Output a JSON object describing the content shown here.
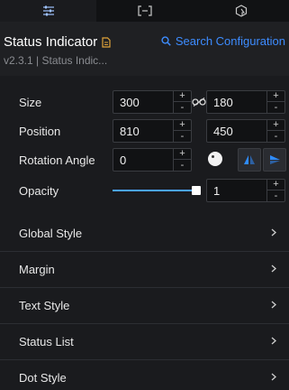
{
  "tabs": [
    {
      "name": "tab-style-settings",
      "icon": "sliders-icon",
      "active": true
    },
    {
      "name": "tab-data",
      "icon": "bracket-data-icon",
      "active": false
    },
    {
      "name": "tab-interaction",
      "icon": "interaction-icon",
      "active": false
    }
  ],
  "header": {
    "title": "Status Indicator",
    "search_label": "Search Configuration",
    "version": "v2.3.1 | Status Indic..."
  },
  "properties": {
    "size": {
      "label": "Size",
      "width": "300",
      "height": "180"
    },
    "position": {
      "label": "Position",
      "x": "810",
      "y": "450"
    },
    "rotation": {
      "label": "Rotation Angle",
      "value": "0"
    },
    "opacity": {
      "label": "Opacity",
      "value": "1",
      "level": 1.0
    }
  },
  "spinner": {
    "up": "+",
    "down": "-"
  },
  "sections": [
    {
      "label": "Global Style"
    },
    {
      "label": "Margin"
    },
    {
      "label": "Text Style"
    },
    {
      "label": "Status List"
    },
    {
      "label": "Dot Style"
    }
  ],
  "colors": {
    "accent": "#3d8cff",
    "panel_bg": "#1a1b1e",
    "doc_icon": "#e0a33a"
  }
}
